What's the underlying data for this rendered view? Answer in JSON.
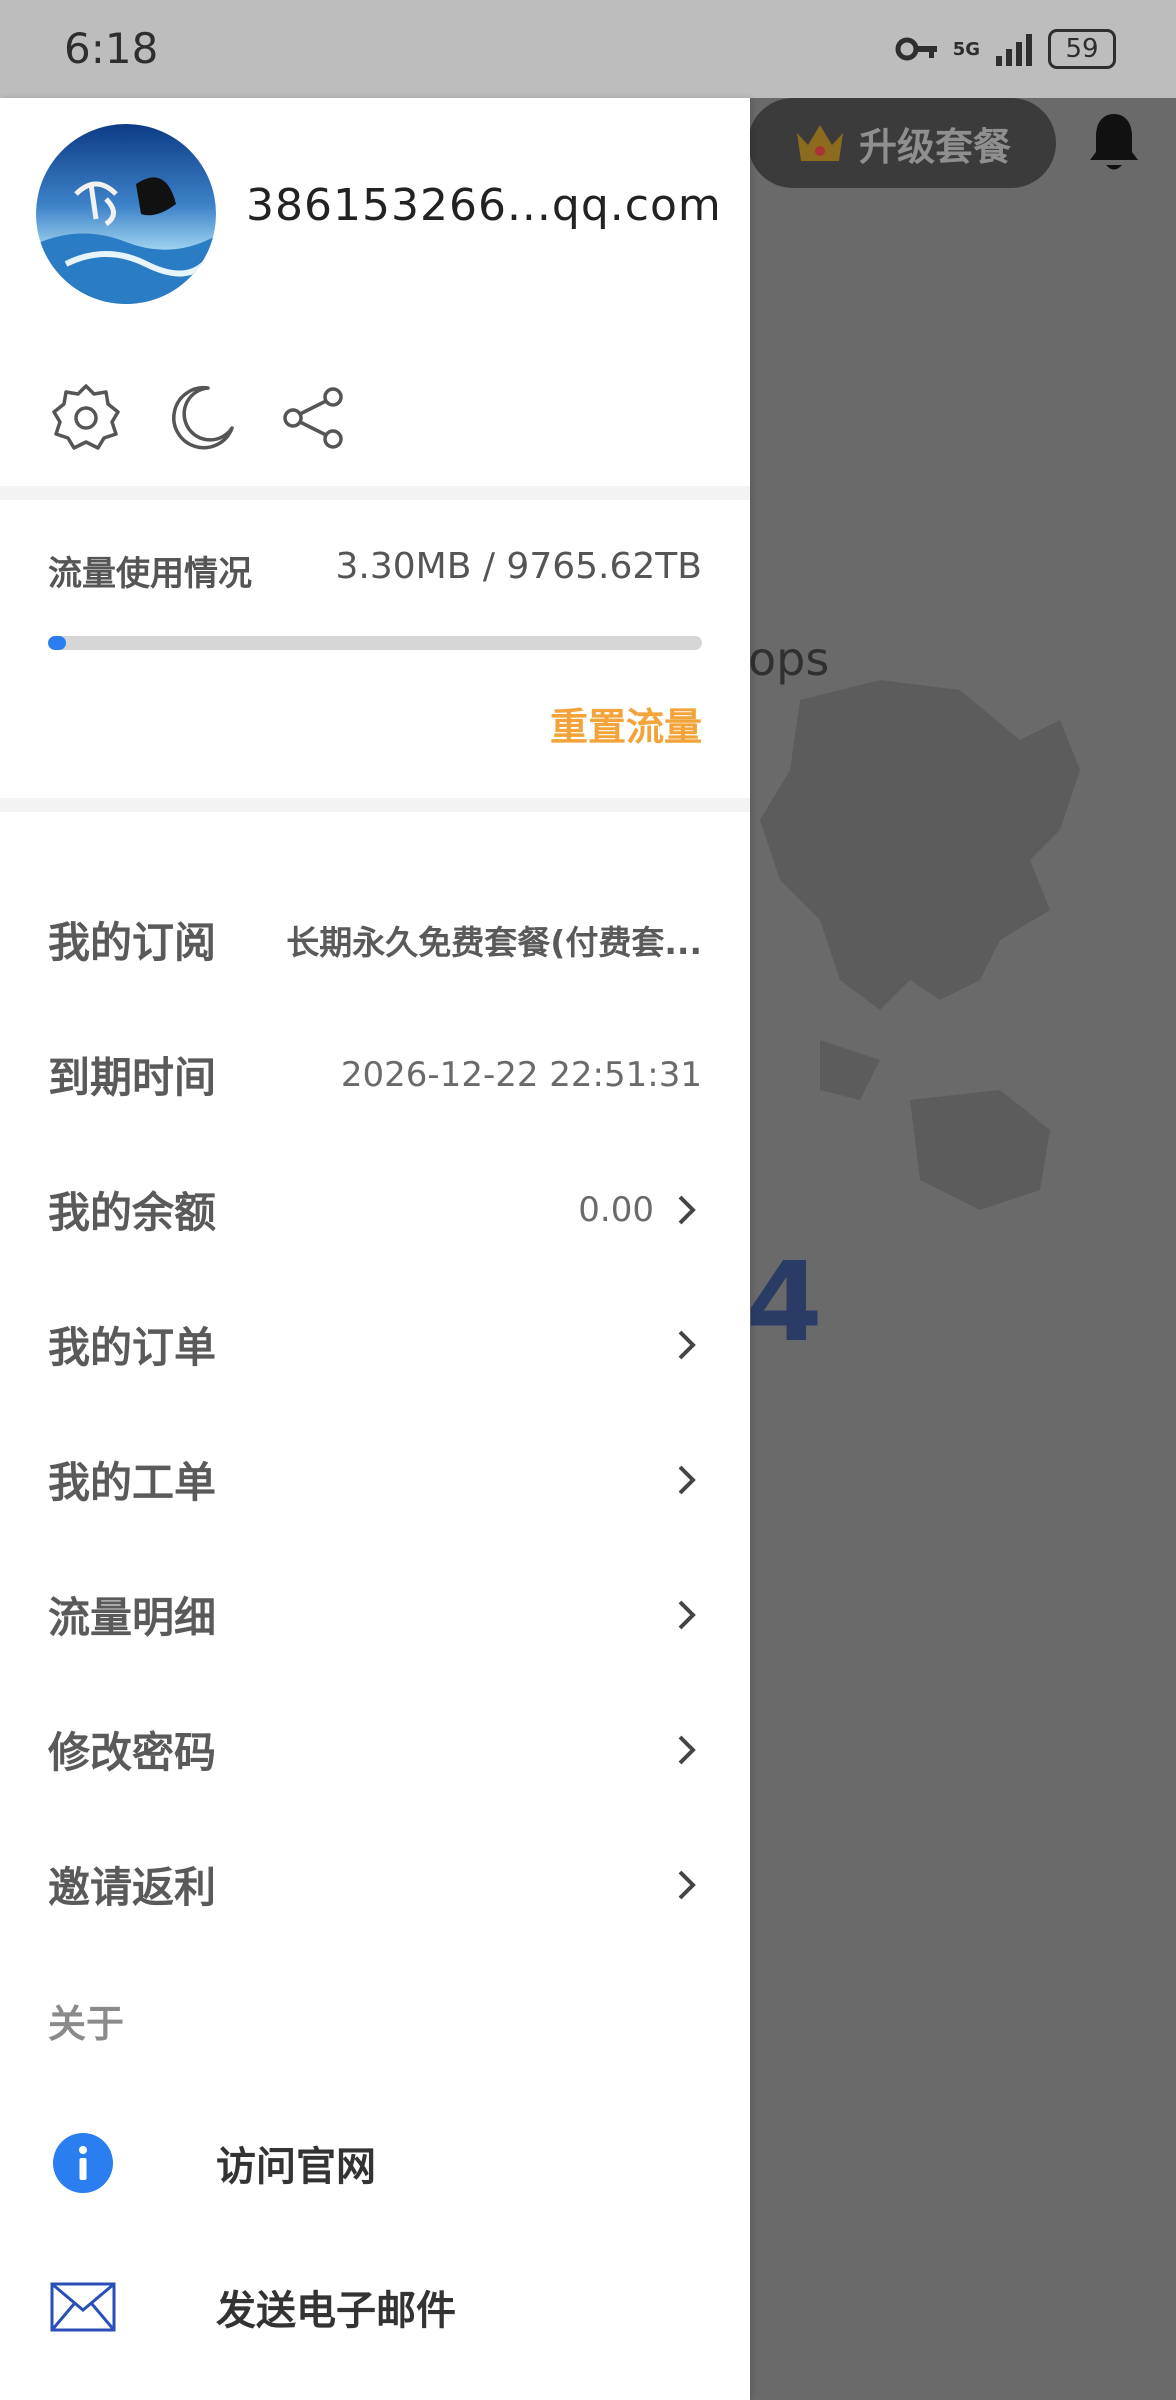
{
  "status_bar": {
    "time": "6:18",
    "network": "5G",
    "battery": "59"
  },
  "background": {
    "upgrade_label": "升级套餐",
    "partial_text": "ops",
    "partial_number": "4"
  },
  "drawer": {
    "email": "386153266...qq.com",
    "traffic": {
      "label": "流量使用情况",
      "value": "3.30MB / 9765.62TB",
      "progress_fraction": 0.003,
      "reset_label": "重置流量"
    },
    "menu": [
      {
        "label": "我的订阅",
        "value": "长期永久免费套餐(付费套...",
        "chevron": false
      },
      {
        "label": "到期时间",
        "value": "2026-12-22 22:51:31",
        "chevron": false
      },
      {
        "label": "我的余额",
        "value": "0.00",
        "chevron": true
      },
      {
        "label": "我的订单",
        "value": "",
        "chevron": true
      },
      {
        "label": "我的工单",
        "value": "",
        "chevron": true
      },
      {
        "label": "流量明细",
        "value": "",
        "chevron": true
      },
      {
        "label": "修改密码",
        "value": "",
        "chevron": true
      },
      {
        "label": "邀请返利",
        "value": "",
        "chevron": true
      }
    ],
    "about": {
      "label": "关于",
      "items": [
        {
          "label": "访问官网",
          "icon": "info-icon"
        },
        {
          "label": "发送电子邮件",
          "icon": "mail-icon"
        }
      ]
    }
  },
  "colors": {
    "accent_blue": "#2a7ef0",
    "reset_orange": "#f2a43a",
    "overlay": "#6a6a6a"
  }
}
